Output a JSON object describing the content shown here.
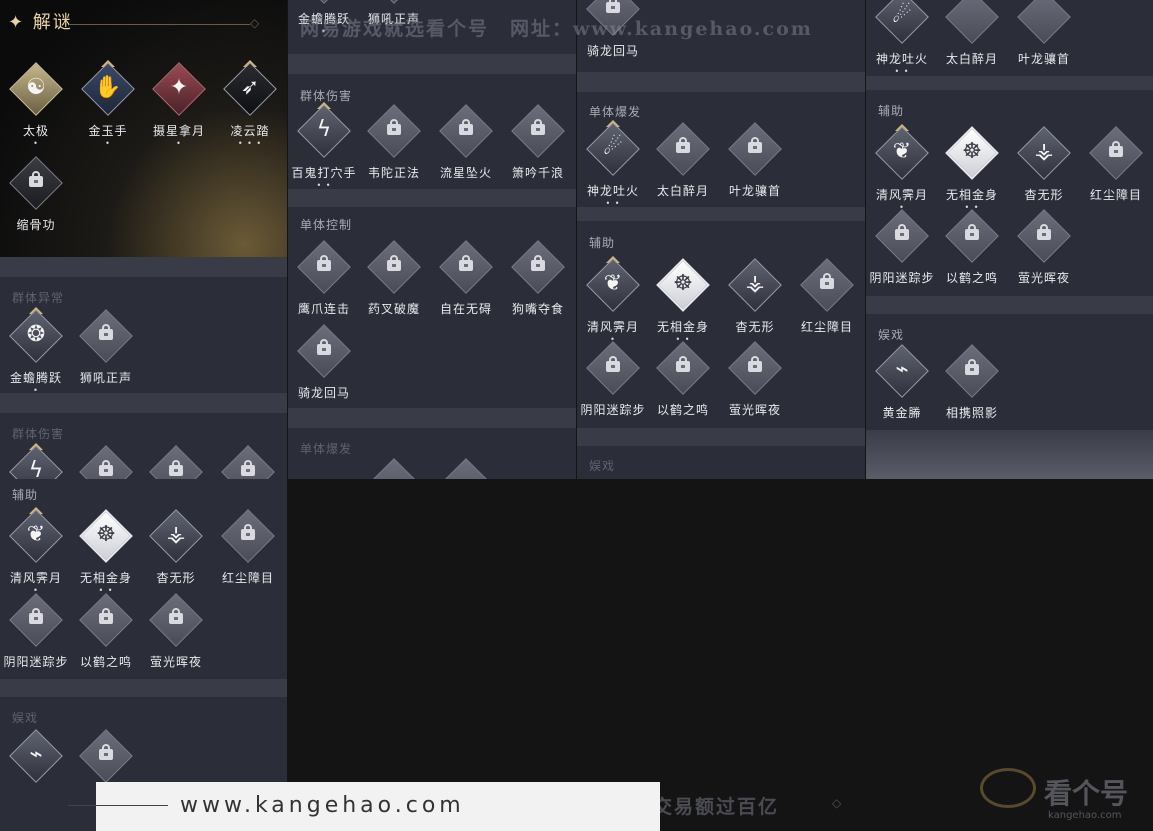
{
  "header": {
    "title": "✦ 解谜",
    "ornament": "◇"
  },
  "labels": {
    "group_abnormal": "群体异常",
    "group_damage": "群体伤害",
    "single_control": "单体控制",
    "single_burst": "单体爆发",
    "support": "辅助",
    "entertainment": "娱戏"
  },
  "skills": {
    "taiji": "太极",
    "jinyushou": "金玉手",
    "zhaixingnayue": "摄星拿月",
    "lingyunta": "凌云踏",
    "suogugong": "缩骨功",
    "jinchantengyue": "金蟾腾跃",
    "shihouzhengsheng": "狮吼正声",
    "baiguidaxueshou": "百鬼打穴手",
    "weituozhengfa": "韦陀正法",
    "liuxingzhuihuo": "流星坠火",
    "xiaoyinqianlang": "箫吟千浪",
    "yingzhualianji": "鹰爪连击",
    "yaochapomo": "药叉破魔",
    "zizaiwuai": "自在无碍",
    "goushouduoshi": "狗嘴夺食",
    "qilonghuima": "骑龙回马",
    "shenlongtuhuo": "神龙吐火",
    "taibaizuiyue": "太白醉月",
    "yelongxiangshou": "叶龙骧首",
    "qingfengjiyue": "清风霁月",
    "wuxiangjinshen": "无相金身",
    "yaowuxing": "杳无形",
    "hongchenzhangmu": "红尘障目",
    "yinyangmizongbu": "阴阳迷踪步",
    "yihezhiming": "以鹤之鸣",
    "yingguanghuiye": "萤光晖夜",
    "huangjinteng": "黄金幐",
    "xiangxiezhaoying": "相携照影"
  },
  "dots": {
    "one": "•",
    "two": "• •",
    "three": "• • •"
  },
  "watermark": {
    "top": "网易游戏就选看个号　网址：www.kangehao.com",
    "bottom": "看个号专业网易游戏八年　年交易额过百亿",
    "brand": "看个号",
    "brand_url": "kangehao.com",
    "ornament": "◇"
  },
  "footer": {
    "url": "www.kangehao.com"
  },
  "icons": {
    "taiji": "☯",
    "jinyushou": "✋",
    "zhaixingnayue": "✦",
    "lingyunta": "➶",
    "jinchantengyue": "❂",
    "baiguidaxueshou": "ϟ",
    "shenlongtuhuo": "☄",
    "qingfengjiyue": "❦",
    "wuxiangjinshen": "☸",
    "yaowuxing": "⚶",
    "huangjinteng": "⌁"
  },
  "colors": {
    "accent_gold": "#d7b77a",
    "panel": "#2b2e38",
    "band": "#393c46",
    "background": "#141414"
  }
}
